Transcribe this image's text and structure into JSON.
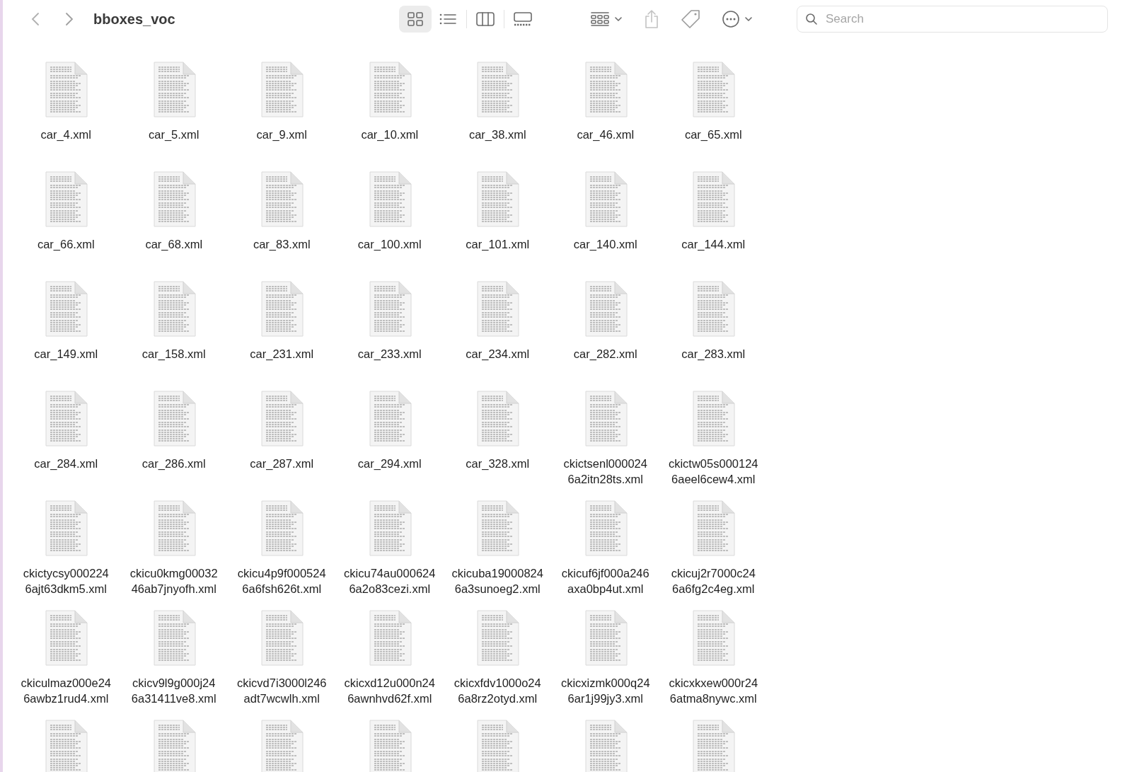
{
  "toolbar": {
    "title": "bboxes_voc",
    "view_modes": [
      {
        "kind": "icons",
        "selected": true
      },
      {
        "kind": "list",
        "selected": false
      },
      {
        "kind": "columns",
        "selected": false
      },
      {
        "kind": "gallery",
        "selected": false
      }
    ],
    "search": {
      "placeholder": "Search"
    }
  },
  "files": [
    {
      "name": "car_4.xml"
    },
    {
      "name": "car_5.xml"
    },
    {
      "name": "car_9.xml"
    },
    {
      "name": "car_10.xml"
    },
    {
      "name": "car_38.xml"
    },
    {
      "name": "car_46.xml"
    },
    {
      "name": "car_65.xml"
    },
    {
      "name": "car_66.xml"
    },
    {
      "name": "car_68.xml"
    },
    {
      "name": "car_83.xml"
    },
    {
      "name": "car_100.xml"
    },
    {
      "name": "car_101.xml"
    },
    {
      "name": "car_140.xml"
    },
    {
      "name": "car_144.xml"
    },
    {
      "name": "car_149.xml"
    },
    {
      "name": "car_158.xml"
    },
    {
      "name": "car_231.xml"
    },
    {
      "name": "car_233.xml"
    },
    {
      "name": "car_234.xml"
    },
    {
      "name": "car_282.xml"
    },
    {
      "name": "car_283.xml"
    },
    {
      "name": "car_284.xml"
    },
    {
      "name": "car_286.xml"
    },
    {
      "name": "car_287.xml"
    },
    {
      "name": "car_294.xml"
    },
    {
      "name": "car_328.xml"
    },
    {
      "name": "ckictsenl000024 6a2itn28ts.xml"
    },
    {
      "name": "ckictw05s000124 6aeel6cew4.xml"
    },
    {
      "name": "ckictycsy000224 6ajt63dkm5.xml"
    },
    {
      "name": "ckicu0kmg00032 46ab7jnyofh.xml"
    },
    {
      "name": "ckicu4p9f000524 6a6fsh626t.xml"
    },
    {
      "name": "ckicu74au000624 6a2o83cezi.xml"
    },
    {
      "name": "ckicuba19000824 6a3sunoeg2.xml"
    },
    {
      "name": "ckicuf6jf000a246 axa0bp4ut.xml"
    },
    {
      "name": "ckicuj2r7000c24 6a6fg2c4eg.xml"
    },
    {
      "name": "ckiculmaz000e24 6awbz1rud4.xml"
    },
    {
      "name": "ckicv9l9g000j24 6a31411ve8.xml"
    },
    {
      "name": "ckicvd7i3000l246 adt7wcwlh.xml"
    },
    {
      "name": "ckicxd12u000n24 6awnhvd62f.xml"
    },
    {
      "name": "ckicxfdv1000o24 6a8rz2otyd.xml"
    },
    {
      "name": "ckicxizmk000q24 6ar1j99jy3.xml"
    },
    {
      "name": "ckicxkxew000r24 6atma8nywc.xml"
    },
    {
      "kind": "cut_off"
    },
    {
      "kind": "cut_off"
    },
    {
      "kind": "cut_off"
    },
    {
      "kind": "cut_off"
    },
    {
      "kind": "cut_off"
    },
    {
      "kind": "cut_off"
    },
    {
      "kind": "cut_off"
    }
  ]
}
